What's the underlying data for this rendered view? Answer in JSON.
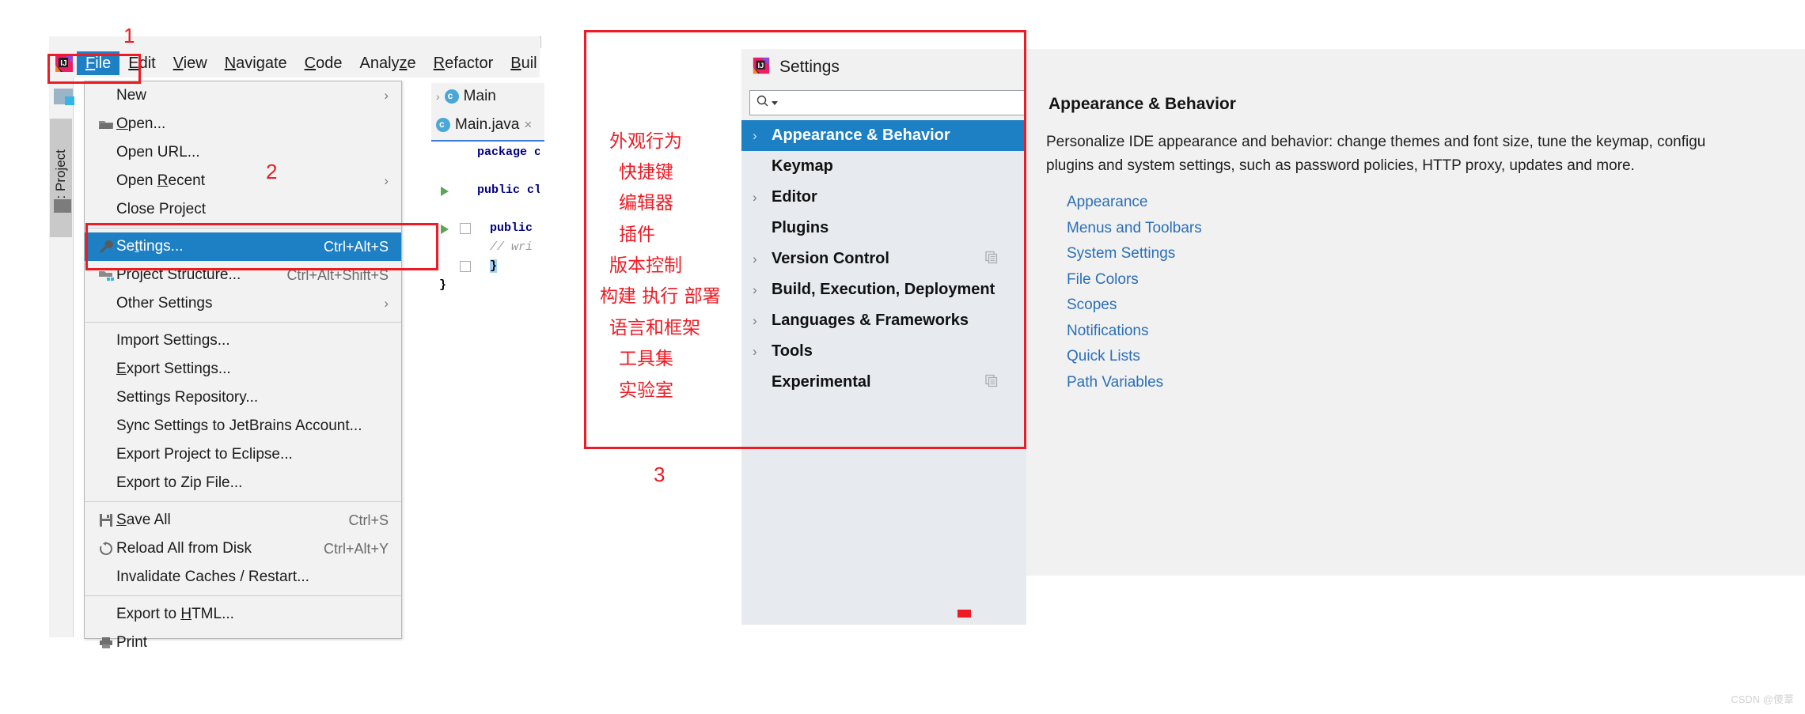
{
  "menubar": {
    "logo_icon": "intellij-idea-logo",
    "items": [
      {
        "label": "File",
        "mnemonic": "F",
        "active": true
      },
      {
        "label": "Edit",
        "mnemonic": "E",
        "active": false
      },
      {
        "label": "View",
        "mnemonic": "V",
        "active": false
      },
      {
        "label": "Navigate",
        "mnemonic": "N",
        "active": false
      },
      {
        "label": "Code",
        "mnemonic": "C",
        "active": false
      },
      {
        "label": "Analyze",
        "mnemonic": "z",
        "active": false
      },
      {
        "label": "Refactor",
        "mnemonic": "R",
        "active": false
      },
      {
        "label": "Build",
        "mnemonic": "B",
        "active": false
      }
    ]
  },
  "tool_window": {
    "project_tab_label": "1: Project",
    "folder_icon": "folder-icon"
  },
  "editor": {
    "breadcrumb": "Main",
    "tab_label": "Main.java",
    "tab_close": "×",
    "file_icon": "java-class-icon",
    "code_lines": [
      "package co",
      "public cla",
      "public",
      "// wri",
      "}",
      "}"
    ]
  },
  "file_menu": {
    "items": [
      {
        "label": "New",
        "mnemonic": "",
        "accel": "",
        "submenu": true,
        "icon": "",
        "separator_after": false
      },
      {
        "label": "Open...",
        "mnemonic": "O",
        "accel": "",
        "submenu": false,
        "icon": "folder-open-icon",
        "separator_after": false
      },
      {
        "label": "Open URL...",
        "mnemonic": "",
        "accel": "",
        "submenu": false,
        "icon": "",
        "separator_after": false
      },
      {
        "label": "Open Recent",
        "mnemonic": "R",
        "accel": "",
        "submenu": true,
        "icon": "",
        "separator_after": false
      },
      {
        "label": "Close Project",
        "mnemonic": "",
        "accel": "",
        "submenu": false,
        "icon": "",
        "separator_after": true
      },
      {
        "label": "Settings...",
        "mnemonic": "t",
        "accel": "Ctrl+Alt+S",
        "submenu": false,
        "icon": "wrench-icon",
        "selected": true,
        "separator_after": false
      },
      {
        "label": "Project Structure...",
        "mnemonic": "",
        "accel": "Ctrl+Alt+Shift+S",
        "submenu": false,
        "icon": "project-structure-icon",
        "separator_after": false
      },
      {
        "label": "Other Settings",
        "mnemonic": "",
        "accel": "",
        "submenu": true,
        "icon": "",
        "separator_after": true
      },
      {
        "label": "Import Settings...",
        "mnemonic": "",
        "accel": "",
        "submenu": false,
        "icon": "",
        "separator_after": false
      },
      {
        "label": "Export Settings...",
        "mnemonic": "E",
        "accel": "",
        "submenu": false,
        "icon": "",
        "separator_after": false
      },
      {
        "label": "Settings Repository...",
        "mnemonic": "",
        "accel": "",
        "submenu": false,
        "icon": "",
        "separator_after": false
      },
      {
        "label": "Sync Settings to JetBrains Account...",
        "mnemonic": "",
        "accel": "",
        "submenu": false,
        "icon": "",
        "separator_after": false
      },
      {
        "label": "Export Project to Eclipse...",
        "mnemonic": "",
        "accel": "",
        "submenu": false,
        "icon": "",
        "separator_after": false
      },
      {
        "label": "Export to Zip File...",
        "mnemonic": "",
        "accel": "",
        "submenu": false,
        "icon": "",
        "separator_after": true
      },
      {
        "label": "Save All",
        "mnemonic": "S",
        "accel": "Ctrl+S",
        "submenu": false,
        "icon": "save-icon",
        "separator_after": false
      },
      {
        "label": "Reload All from Disk",
        "mnemonic": "",
        "accel": "Ctrl+Alt+Y",
        "submenu": false,
        "icon": "reload-icon",
        "separator_after": false
      },
      {
        "label": "Invalidate Caches / Restart...",
        "mnemonic": "",
        "accel": "",
        "submenu": false,
        "icon": "",
        "separator_after": true
      },
      {
        "label": "Export to HTML...",
        "mnemonic": "H",
        "accel": "",
        "submenu": false,
        "icon": "",
        "separator_after": false
      },
      {
        "label": "Print",
        "mnemonic": "",
        "accel": "",
        "submenu": false,
        "icon": "print-icon",
        "separator_after": false
      }
    ]
  },
  "settings_dialog": {
    "title": "Settings",
    "title_icon": "intellij-idea-logo",
    "search_placeholder": "",
    "search_value": "",
    "search_icon": "search-icon",
    "tree": [
      {
        "label": "Appearance & Behavior",
        "twisty": true,
        "selected": true,
        "copy_icon": false
      },
      {
        "label": "Keymap",
        "twisty": false,
        "selected": false,
        "copy_icon": false
      },
      {
        "label": "Editor",
        "twisty": true,
        "selected": false,
        "copy_icon": false
      },
      {
        "label": "Plugins",
        "twisty": false,
        "selected": false,
        "copy_icon": false
      },
      {
        "label": "Version Control",
        "twisty": true,
        "selected": false,
        "copy_icon": true
      },
      {
        "label": "Build, Execution, Deployment",
        "twisty": true,
        "selected": false,
        "copy_icon": false
      },
      {
        "label": "Languages & Frameworks",
        "twisty": true,
        "selected": false,
        "copy_icon": false
      },
      {
        "label": "Tools",
        "twisty": true,
        "selected": false,
        "copy_icon": false
      },
      {
        "label": "Experimental",
        "twisty": false,
        "selected": false,
        "copy_icon": true
      }
    ]
  },
  "detail_panel": {
    "title": "Appearance & Behavior",
    "description": "Personalize IDE appearance and behavior: change themes and font size, tune the keymap, configu\nplugins and system settings, such as password policies, HTTP proxy, updates and more.",
    "links": [
      "Appearance",
      "Menus and Toolbars",
      "System Settings",
      "File Colors",
      "Scopes",
      "Notifications",
      "Quick Lists",
      "Path Variables"
    ]
  },
  "annotations": {
    "chinese_labels": [
      "外观行为",
      "快捷键",
      "编辑器",
      "插件",
      "版本控制",
      "构建 执行 部署",
      "语言和框架",
      "工具集",
      "实验室"
    ],
    "numbers": [
      "1",
      "2",
      "3"
    ],
    "box_color": "#ee1b24"
  },
  "watermark": "CSDN @傻葦"
}
